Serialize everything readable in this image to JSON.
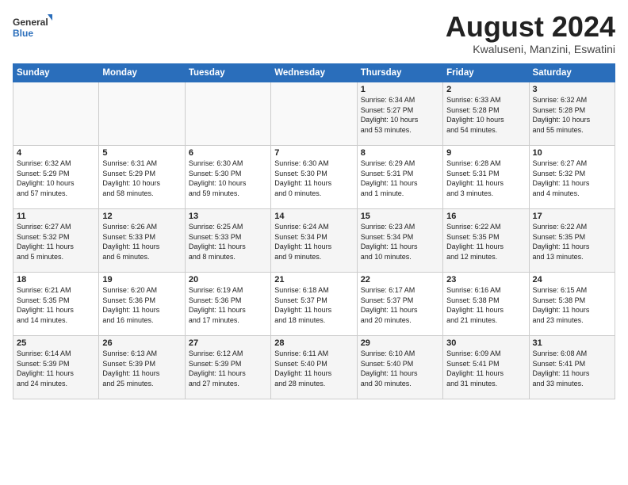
{
  "logo": {
    "general": "General",
    "blue": "Blue"
  },
  "title": "August 2024",
  "subtitle": "Kwaluseni, Manzini, Eswatini",
  "days_header": [
    "Sunday",
    "Monday",
    "Tuesday",
    "Wednesday",
    "Thursday",
    "Friday",
    "Saturday"
  ],
  "weeks": [
    [
      {
        "day": "",
        "info": ""
      },
      {
        "day": "",
        "info": ""
      },
      {
        "day": "",
        "info": ""
      },
      {
        "day": "",
        "info": ""
      },
      {
        "day": "1",
        "info": "Sunrise: 6:34 AM\nSunset: 5:27 PM\nDaylight: 10 hours\nand 53 minutes."
      },
      {
        "day": "2",
        "info": "Sunrise: 6:33 AM\nSunset: 5:28 PM\nDaylight: 10 hours\nand 54 minutes."
      },
      {
        "day": "3",
        "info": "Sunrise: 6:32 AM\nSunset: 5:28 PM\nDaylight: 10 hours\nand 55 minutes."
      }
    ],
    [
      {
        "day": "4",
        "info": "Sunrise: 6:32 AM\nSunset: 5:29 PM\nDaylight: 10 hours\nand 57 minutes."
      },
      {
        "day": "5",
        "info": "Sunrise: 6:31 AM\nSunset: 5:29 PM\nDaylight: 10 hours\nand 58 minutes."
      },
      {
        "day": "6",
        "info": "Sunrise: 6:30 AM\nSunset: 5:30 PM\nDaylight: 10 hours\nand 59 minutes."
      },
      {
        "day": "7",
        "info": "Sunrise: 6:30 AM\nSunset: 5:30 PM\nDaylight: 11 hours\nand 0 minutes."
      },
      {
        "day": "8",
        "info": "Sunrise: 6:29 AM\nSunset: 5:31 PM\nDaylight: 11 hours\nand 1 minute."
      },
      {
        "day": "9",
        "info": "Sunrise: 6:28 AM\nSunset: 5:31 PM\nDaylight: 11 hours\nand 3 minutes."
      },
      {
        "day": "10",
        "info": "Sunrise: 6:27 AM\nSunset: 5:32 PM\nDaylight: 11 hours\nand 4 minutes."
      }
    ],
    [
      {
        "day": "11",
        "info": "Sunrise: 6:27 AM\nSunset: 5:32 PM\nDaylight: 11 hours\nand 5 minutes."
      },
      {
        "day": "12",
        "info": "Sunrise: 6:26 AM\nSunset: 5:33 PM\nDaylight: 11 hours\nand 6 minutes."
      },
      {
        "day": "13",
        "info": "Sunrise: 6:25 AM\nSunset: 5:33 PM\nDaylight: 11 hours\nand 8 minutes."
      },
      {
        "day": "14",
        "info": "Sunrise: 6:24 AM\nSunset: 5:34 PM\nDaylight: 11 hours\nand 9 minutes."
      },
      {
        "day": "15",
        "info": "Sunrise: 6:23 AM\nSunset: 5:34 PM\nDaylight: 11 hours\nand 10 minutes."
      },
      {
        "day": "16",
        "info": "Sunrise: 6:22 AM\nSunset: 5:35 PM\nDaylight: 11 hours\nand 12 minutes."
      },
      {
        "day": "17",
        "info": "Sunrise: 6:22 AM\nSunset: 5:35 PM\nDaylight: 11 hours\nand 13 minutes."
      }
    ],
    [
      {
        "day": "18",
        "info": "Sunrise: 6:21 AM\nSunset: 5:35 PM\nDaylight: 11 hours\nand 14 minutes."
      },
      {
        "day": "19",
        "info": "Sunrise: 6:20 AM\nSunset: 5:36 PM\nDaylight: 11 hours\nand 16 minutes."
      },
      {
        "day": "20",
        "info": "Sunrise: 6:19 AM\nSunset: 5:36 PM\nDaylight: 11 hours\nand 17 minutes."
      },
      {
        "day": "21",
        "info": "Sunrise: 6:18 AM\nSunset: 5:37 PM\nDaylight: 11 hours\nand 18 minutes."
      },
      {
        "day": "22",
        "info": "Sunrise: 6:17 AM\nSunset: 5:37 PM\nDaylight: 11 hours\nand 20 minutes."
      },
      {
        "day": "23",
        "info": "Sunrise: 6:16 AM\nSunset: 5:38 PM\nDaylight: 11 hours\nand 21 minutes."
      },
      {
        "day": "24",
        "info": "Sunrise: 6:15 AM\nSunset: 5:38 PM\nDaylight: 11 hours\nand 23 minutes."
      }
    ],
    [
      {
        "day": "25",
        "info": "Sunrise: 6:14 AM\nSunset: 5:39 PM\nDaylight: 11 hours\nand 24 minutes."
      },
      {
        "day": "26",
        "info": "Sunrise: 6:13 AM\nSunset: 5:39 PM\nDaylight: 11 hours\nand 25 minutes."
      },
      {
        "day": "27",
        "info": "Sunrise: 6:12 AM\nSunset: 5:39 PM\nDaylight: 11 hours\nand 27 minutes."
      },
      {
        "day": "28",
        "info": "Sunrise: 6:11 AM\nSunset: 5:40 PM\nDaylight: 11 hours\nand 28 minutes."
      },
      {
        "day": "29",
        "info": "Sunrise: 6:10 AM\nSunset: 5:40 PM\nDaylight: 11 hours\nand 30 minutes."
      },
      {
        "day": "30",
        "info": "Sunrise: 6:09 AM\nSunset: 5:41 PM\nDaylight: 11 hours\nand 31 minutes."
      },
      {
        "day": "31",
        "info": "Sunrise: 6:08 AM\nSunset: 5:41 PM\nDaylight: 11 hours\nand 33 minutes."
      }
    ]
  ]
}
